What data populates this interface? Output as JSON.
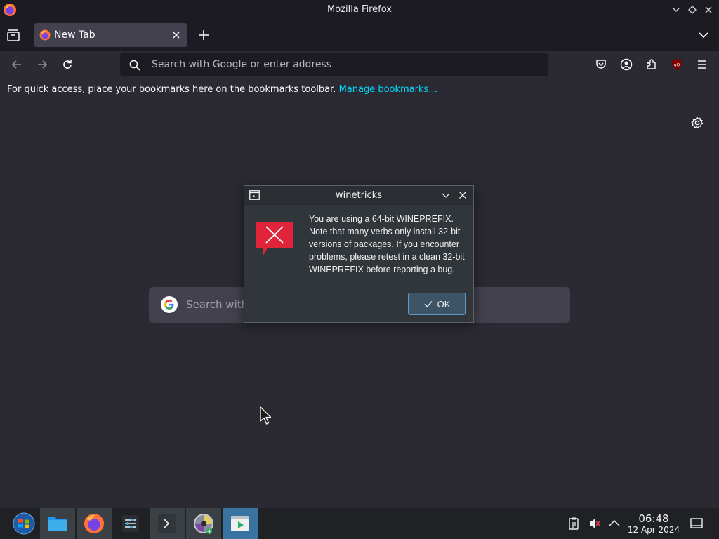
{
  "window": {
    "title": "Mozilla Firefox"
  },
  "tabs": [
    {
      "label": "New Tab",
      "active": true
    }
  ],
  "urlbar": {
    "placeholder": "Search with Google or enter address"
  },
  "bookmarks_bar": {
    "text": "For quick access, place your bookmarks here on the bookmarks toolbar.",
    "link": "Manage bookmarks…"
  },
  "newtab": {
    "search_placeholder": "Search with Google or enter address"
  },
  "dialog": {
    "title": "winetricks",
    "message": "You are using a 64-bit WINEPREFIX. Note that many verbs only install 32-bit versions of packages. If you encounter problems, please retest in a clean 32-bit WINEPREFIX before reporting a bug.",
    "ok_label": "OK"
  },
  "taskbar": {
    "apps": [
      "start-menu",
      "file-manager",
      "firefox",
      "settings",
      "terminal",
      "disc-burner",
      "winetricks"
    ],
    "clock": {
      "time": "06:48",
      "date": "12 Apr 2024"
    }
  },
  "colors": {
    "accent": "#00ddff",
    "dialog_button_border": "#5e9dcb",
    "error_red": "#e0243a"
  }
}
